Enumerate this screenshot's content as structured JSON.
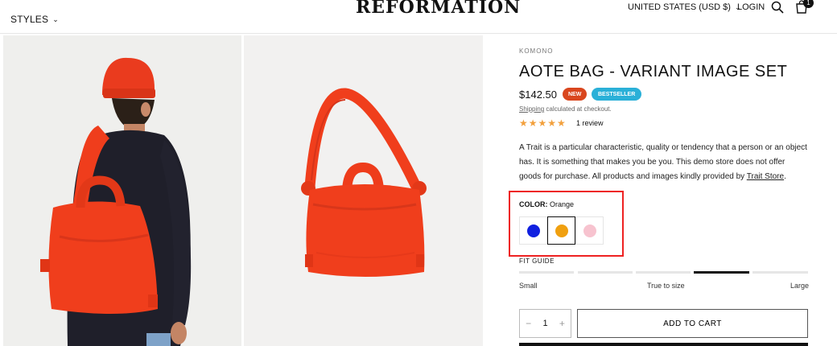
{
  "header": {
    "styles_label": "STYLES",
    "logo": "REFORMATION",
    "country": "UNITED STATES (USD $)",
    "login": "LOGIN",
    "cart_count": "1"
  },
  "product": {
    "vendor": "KOMONO",
    "title": "AOTE BAG - VARIANT IMAGE SET",
    "price": "$142.50",
    "badges": [
      "NEW",
      "BESTSELLER"
    ],
    "shipping_link": "Shipping",
    "shipping_text": " calculated at checkout.",
    "stars": "★★★★★",
    "reviews": "1 review",
    "description_1": "A Trait is a particular characteristic, quality or tendency that a person or an object has. It is something that makes you be you. This demo store does not offer goods for purchase. All products and images kindly provided by ",
    "description_link": "Trait Store",
    "description_end": ".",
    "color_label": "COLOR:",
    "color_value": "Orange",
    "swatches": [
      {
        "name": "Blue",
        "color": "#1020e0"
      },
      {
        "name": "Orange",
        "color": "#f0a010"
      },
      {
        "name": "Pink",
        "color": "#f7c3cf"
      }
    ],
    "fit_guide": "FIT GUIDE",
    "fit_labels": [
      "Small",
      "True to size",
      "Large"
    ],
    "quantity": "1",
    "add_to_cart": "ADD TO CART"
  },
  "colors": {
    "bag": "#f03e1c",
    "highlight": "#e22222"
  }
}
